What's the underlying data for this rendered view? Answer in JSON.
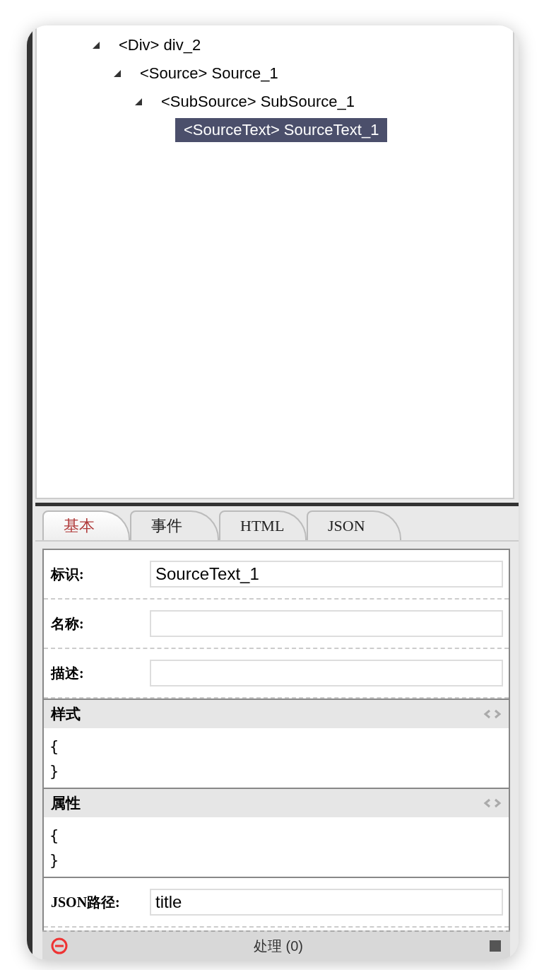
{
  "tree": [
    {
      "label": "<Div> div_2",
      "selected": false,
      "expanded": true,
      "children": [
        {
          "label": "<Source> Source_1",
          "selected": false,
          "expanded": true,
          "children": [
            {
              "label": "<SubSource> SubSource_1",
              "selected": false,
              "expanded": true,
              "children": [
                {
                  "label": "<SourceText> SourceText_1",
                  "selected": true
                }
              ]
            }
          ]
        }
      ]
    }
  ],
  "tabs": [
    {
      "label": "基本",
      "selected": true
    },
    {
      "label": "事件",
      "selected": false
    },
    {
      "label": "HTML",
      "selected": false
    },
    {
      "label": "JSON",
      "selected": false
    }
  ],
  "form": [
    {
      "kind": "field",
      "label": "标识:",
      "value": "SourceText_1"
    },
    {
      "kind": "field",
      "label": "名称:"
    },
    {
      "kind": "field",
      "label": "描述:"
    },
    {
      "kind": "code",
      "label": "样式",
      "lines": [
        "{",
        "}"
      ]
    },
    {
      "kind": "code",
      "label": "属性",
      "lines": [
        "{",
        "}"
      ]
    },
    {
      "kind": "field",
      "label": "JSON路径:",
      "value": "title"
    }
  ],
  "status_bar": {
    "label": "处理 (0)"
  }
}
